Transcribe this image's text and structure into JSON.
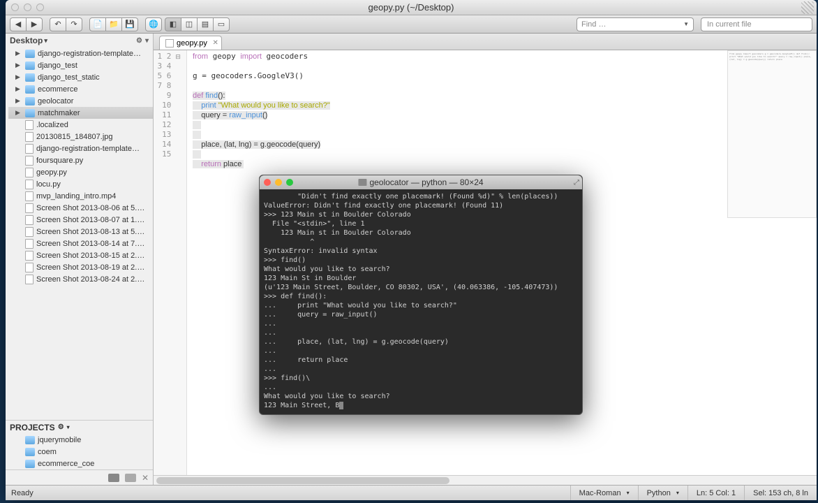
{
  "window": {
    "title": "geopy.py (~/Desktop)"
  },
  "find": {
    "placeholder": "Find …",
    "scope": "In current file"
  },
  "sidebar": {
    "root_label": "Desktop",
    "folders": [
      {
        "name": "django-registration-template…"
      },
      {
        "name": "django_test"
      },
      {
        "name": "django_test_static"
      },
      {
        "name": "ecommerce"
      },
      {
        "name": "geolocator"
      },
      {
        "name": "matchmaker",
        "selected": true
      }
    ],
    "files": [
      {
        "name": ".localized"
      },
      {
        "name": "20130815_184807.jpg"
      },
      {
        "name": "django-registration-template…"
      },
      {
        "name": "foursquare.py"
      },
      {
        "name": "geopy.py"
      },
      {
        "name": "locu.py"
      },
      {
        "name": "mvp_landing_intro.mp4"
      },
      {
        "name": "Screen Shot 2013-08-06 at 5.…"
      },
      {
        "name": "Screen Shot 2013-08-07 at 1.…"
      },
      {
        "name": "Screen Shot 2013-08-13 at 5.…"
      },
      {
        "name": "Screen Shot 2013-08-14 at 7.…"
      },
      {
        "name": "Screen Shot 2013-08-15 at 2.…"
      },
      {
        "name": "Screen Shot 2013-08-19 at 2.…"
      },
      {
        "name": "Screen Shot 2013-08-24 at 2.…"
      }
    ],
    "projects_label": "PROJECTS",
    "projects": [
      {
        "name": "jquerymobile"
      },
      {
        "name": "coem"
      },
      {
        "name": "ecommerce_coe"
      }
    ]
  },
  "tab": {
    "label": "geopy.py"
  },
  "editor": {
    "lines": [
      "1",
      "2",
      "3",
      "4",
      "5",
      "6",
      "7",
      "8",
      "9",
      "10",
      "11",
      "12",
      "13",
      "14",
      "15"
    ]
  },
  "statusbar": {
    "status": "Ready",
    "encoding": "Mac-Roman",
    "language": "Python",
    "position": "Ln: 5 Col: 1",
    "selection": "Sel: 153 ch, 8 ln"
  },
  "terminal": {
    "title": "geolocator — python — 80×24",
    "lines": [
      "        \"Didn't find exactly one placemark! (Found %d)\" % len(places))",
      "ValueError: Didn't find exactly one placemark! (Found 11)",
      ">>> 123 Main st in Boulder Colorado",
      "  File \"<stdin>\", line 1",
      "    123 Main st in Boulder Colorado",
      "           ^",
      "SyntaxError: invalid syntax",
      ">>> find()",
      "What would you like to search?",
      "123 Main St in Boulder",
      "(u'123 Main Street, Boulder, CO 80302, USA', (40.063386, -105.407473))",
      ">>> def find():",
      "...     print \"What would you like to search?\"",
      "...     query = raw_input()",
      "...     ",
      "...     ",
      "...     place, (lat, lng) = g.geocode(query)",
      "...     ",
      "...     return place",
      "... ",
      ">>> find()\\",
      "... ",
      "What would you like to search?",
      "123 Main Street, B"
    ]
  }
}
